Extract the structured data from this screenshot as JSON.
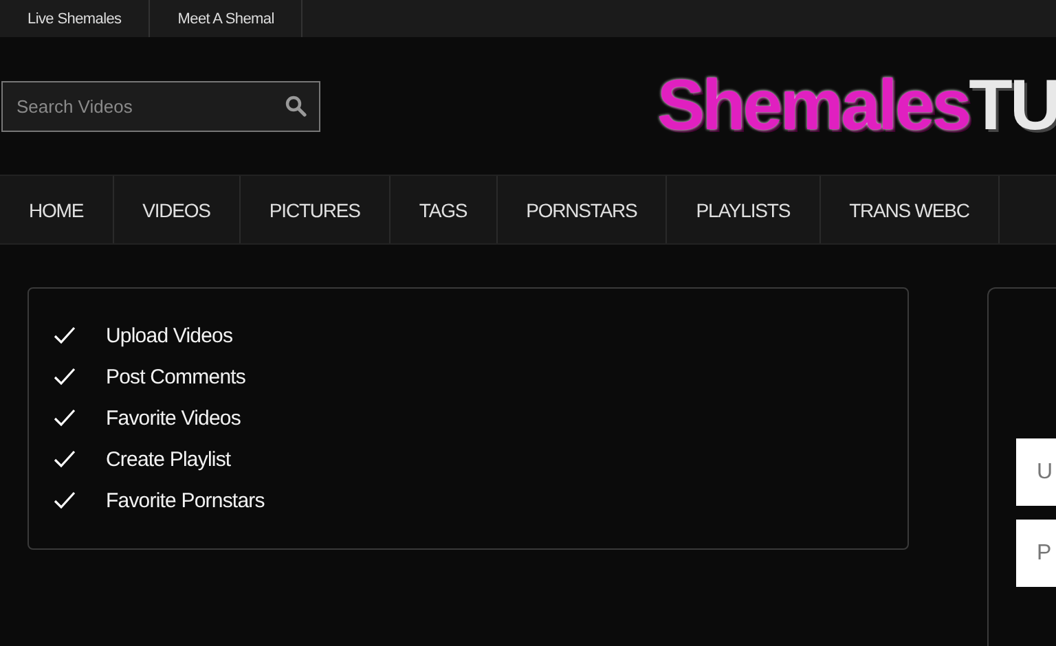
{
  "top_links": [
    "Live Shemales",
    "Meet A Shemal"
  ],
  "search": {
    "placeholder": "Search Videos"
  },
  "logo": {
    "text_1": "Shemales",
    "text_2": "TU"
  },
  "nav": [
    {
      "label": "HOME"
    },
    {
      "label": "VIDEOS"
    },
    {
      "label": "PICTURES"
    },
    {
      "label": "TAGS"
    },
    {
      "label": "PORNSTARS"
    },
    {
      "label": "PLAYLISTS"
    },
    {
      "label": "TRANS WEBC"
    }
  ],
  "benefits": [
    "Upload Videos",
    "Post Comments",
    "Favorite Videos",
    "Create Playlist",
    "Favorite Pornstars"
  ],
  "login": {
    "fields": [
      {
        "placeholder": "U"
      },
      {
        "placeholder": "P"
      }
    ]
  }
}
